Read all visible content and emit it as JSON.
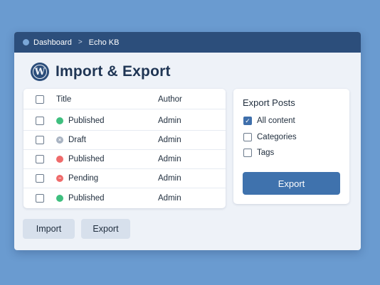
{
  "breadcrumb": {
    "items": [
      "Dashboard",
      "Echo KB"
    ],
    "separator": ">"
  },
  "page": {
    "title": "Import & Export",
    "logo_glyph": "W"
  },
  "table": {
    "headers": {
      "title": "Title",
      "author": "Author"
    },
    "rows": [
      {
        "title": "Published",
        "author": "Admin",
        "status_color": "#3fbf7f",
        "status_glyph": ""
      },
      {
        "title": "Draft",
        "author": "Admin",
        "status_color": "#a8b3c2",
        "status_glyph": "×"
      },
      {
        "title": "Published",
        "author": "Admin",
        "status_color": "#ef6b6b",
        "status_glyph": ""
      },
      {
        "title": "Pending",
        "author": "Admin",
        "status_color": "#ef6b6b",
        "status_glyph": "−"
      },
      {
        "title": "Published",
        "author": "Admin",
        "status_color": "#3fbf7f",
        "status_glyph": ""
      }
    ]
  },
  "export_panel": {
    "title": "Export Posts",
    "options": [
      {
        "label": "All content",
        "checked": true
      },
      {
        "label": "Categories",
        "checked": false
      },
      {
        "label": "Tags",
        "checked": false
      }
    ],
    "button_label": "Export"
  },
  "actions": {
    "import_label": "Import",
    "export_label": "Export"
  },
  "colors": {
    "accent": "#3f72ad",
    "topbar": "#2c4e7b",
    "background": "#6a9bd0"
  }
}
